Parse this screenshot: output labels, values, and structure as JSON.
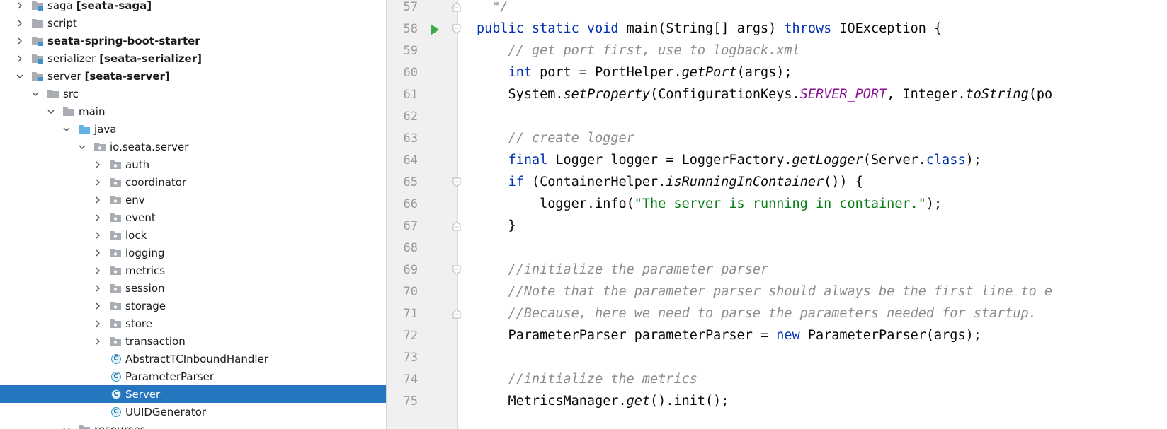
{
  "project_tree": {
    "items": [
      {
        "label": "saga",
        "module": "[seata-saga]",
        "bold": false,
        "arrow": "right",
        "icon": "module-folder-icon",
        "depth": 0
      },
      {
        "label": "script",
        "module": "",
        "bold": false,
        "arrow": "right",
        "icon": "folder-icon",
        "depth": 0
      },
      {
        "label": "seata-spring-boot-starter",
        "module": "",
        "bold": true,
        "arrow": "right",
        "icon": "module-folder-icon",
        "depth": 0
      },
      {
        "label": "serializer",
        "module": "[seata-serializer]",
        "bold": false,
        "arrow": "right",
        "icon": "module-folder-icon",
        "depth": 0
      },
      {
        "label": "server",
        "module": "[seata-server]",
        "bold": false,
        "arrow": "down",
        "icon": "module-folder-icon",
        "depth": 0
      },
      {
        "label": "src",
        "module": "",
        "bold": false,
        "arrow": "down",
        "icon": "folder-icon",
        "depth": 1
      },
      {
        "label": "main",
        "module": "",
        "bold": false,
        "arrow": "down",
        "icon": "folder-icon",
        "depth": 2
      },
      {
        "label": "java",
        "module": "",
        "bold": false,
        "arrow": "down",
        "icon": "source-folder-icon",
        "depth": 3
      },
      {
        "label": "io.seata.server",
        "module": "",
        "bold": false,
        "arrow": "down",
        "icon": "package-icon",
        "depth": 4
      },
      {
        "label": "auth",
        "module": "",
        "bold": false,
        "arrow": "right",
        "icon": "package-icon",
        "depth": 5
      },
      {
        "label": "coordinator",
        "module": "",
        "bold": false,
        "arrow": "right",
        "icon": "package-icon",
        "depth": 5
      },
      {
        "label": "env",
        "module": "",
        "bold": false,
        "arrow": "right",
        "icon": "package-icon",
        "depth": 5
      },
      {
        "label": "event",
        "module": "",
        "bold": false,
        "arrow": "right",
        "icon": "package-icon",
        "depth": 5
      },
      {
        "label": "lock",
        "module": "",
        "bold": false,
        "arrow": "right",
        "icon": "package-icon",
        "depth": 5
      },
      {
        "label": "logging",
        "module": "",
        "bold": false,
        "arrow": "right",
        "icon": "package-icon",
        "depth": 5
      },
      {
        "label": "metrics",
        "module": "",
        "bold": false,
        "arrow": "right",
        "icon": "package-icon",
        "depth": 5
      },
      {
        "label": "session",
        "module": "",
        "bold": false,
        "arrow": "right",
        "icon": "package-icon",
        "depth": 5
      },
      {
        "label": "storage",
        "module": "",
        "bold": false,
        "arrow": "right",
        "icon": "package-icon",
        "depth": 5
      },
      {
        "label": "store",
        "module": "",
        "bold": false,
        "arrow": "right",
        "icon": "package-icon",
        "depth": 5
      },
      {
        "label": "transaction",
        "module": "",
        "bold": false,
        "arrow": "right",
        "icon": "package-icon",
        "depth": 5
      },
      {
        "label": "AbstractTCInboundHandler",
        "module": "",
        "bold": false,
        "arrow": "none",
        "icon": "class-icon",
        "depth": 5
      },
      {
        "label": "ParameterParser",
        "module": "",
        "bold": false,
        "arrow": "none",
        "icon": "class-icon",
        "depth": 5
      },
      {
        "label": "Server",
        "module": "",
        "bold": false,
        "arrow": "none",
        "icon": "class-icon",
        "depth": 5,
        "selected": true
      },
      {
        "label": "UUIDGenerator",
        "module": "",
        "bold": false,
        "arrow": "none",
        "icon": "class-icon",
        "depth": 5
      },
      {
        "label": "resources",
        "module": "",
        "bold": false,
        "arrow": "down",
        "icon": "folder-icon",
        "depth": 3
      }
    ]
  },
  "editor": {
    "lines": [
      {
        "num": "57",
        "run": false,
        "fold": "end",
        "tokens": [
          [
            "  */",
            "cm"
          ]
        ]
      },
      {
        "num": "58",
        "run": true,
        "fold": "start",
        "tokens": [
          [
            "public static void ",
            "kw"
          ],
          [
            "main",
            "fn"
          ],
          [
            "(String[] args) ",
            ""
          ],
          [
            "throws ",
            "kw"
          ],
          [
            "IOException {",
            ""
          ]
        ]
      },
      {
        "num": "59",
        "run": false,
        "fold": "",
        "tokens": [
          [
            "    // get port first, use to logback.xml",
            "cm"
          ]
        ]
      },
      {
        "num": "60",
        "run": false,
        "fold": "",
        "tokens": [
          [
            "    ",
            ""
          ],
          [
            "int ",
            "kw"
          ],
          [
            "port = PortHelper.",
            ""
          ],
          [
            "getPort",
            "it"
          ],
          [
            "(args);",
            ""
          ]
        ]
      },
      {
        "num": "61",
        "run": false,
        "fold": "",
        "tokens": [
          [
            "    System.",
            ""
          ],
          [
            "setProperty",
            "it"
          ],
          [
            "(ConfigurationKeys.",
            ""
          ],
          [
            "SERVER_PORT",
            "cs"
          ],
          [
            ", Integer.",
            ""
          ],
          [
            "toString",
            "it"
          ],
          [
            "(po",
            ""
          ]
        ]
      },
      {
        "num": "62",
        "run": false,
        "fold": "",
        "tokens": [
          [
            "",
            ""
          ]
        ]
      },
      {
        "num": "63",
        "run": false,
        "fold": "",
        "tokens": [
          [
            "    // create logger",
            "cm"
          ]
        ]
      },
      {
        "num": "64",
        "run": false,
        "fold": "",
        "tokens": [
          [
            "    ",
            ""
          ],
          [
            "final ",
            "kw"
          ],
          [
            "Logger logger = LoggerFactory.",
            ""
          ],
          [
            "getLogger",
            "it"
          ],
          [
            "(Server.",
            ""
          ],
          [
            "class",
            "kw"
          ],
          [
            ");",
            ""
          ]
        ]
      },
      {
        "num": "65",
        "run": false,
        "fold": "start",
        "tokens": [
          [
            "    ",
            ""
          ],
          [
            "if ",
            "kw"
          ],
          [
            "(ContainerHelper.",
            ""
          ],
          [
            "isRunningInContainer",
            "it"
          ],
          [
            "()) {",
            ""
          ]
        ]
      },
      {
        "num": "66",
        "run": false,
        "fold": "",
        "tokens": [
          [
            "        logger.info(",
            ""
          ],
          [
            "\"The server is running in container.\"",
            "st"
          ],
          [
            ");",
            ""
          ]
        ]
      },
      {
        "num": "67",
        "run": false,
        "fold": "end",
        "tokens": [
          [
            "    }",
            ""
          ]
        ]
      },
      {
        "num": "68",
        "run": false,
        "fold": "",
        "tokens": [
          [
            "",
            ""
          ]
        ]
      },
      {
        "num": "69",
        "run": false,
        "fold": "start",
        "tokens": [
          [
            "    //initialize the parameter parser",
            "cm"
          ]
        ]
      },
      {
        "num": "70",
        "run": false,
        "fold": "",
        "tokens": [
          [
            "    //Note that the parameter parser should always be the first line to e",
            "cm"
          ]
        ]
      },
      {
        "num": "71",
        "run": false,
        "fold": "end",
        "tokens": [
          [
            "    //Because, here we need to parse the parameters needed for startup.",
            "cm"
          ]
        ]
      },
      {
        "num": "72",
        "run": false,
        "fold": "",
        "tokens": [
          [
            "    ParameterParser parameterParser = ",
            ""
          ],
          [
            "new ",
            "kw"
          ],
          [
            "ParameterParser(args);",
            ""
          ]
        ]
      },
      {
        "num": "73",
        "run": false,
        "fold": "",
        "tokens": [
          [
            "",
            ""
          ]
        ]
      },
      {
        "num": "74",
        "run": false,
        "fold": "",
        "tokens": [
          [
            "    //initialize the metrics",
            "cm"
          ]
        ]
      },
      {
        "num": "75",
        "run": false,
        "fold": "",
        "tokens": [
          [
            "    MetricsManager.",
            ""
          ],
          [
            "get",
            "it"
          ],
          [
            "().init();",
            ""
          ]
        ]
      }
    ]
  },
  "colors": {
    "keyword": "#0033b3",
    "comment": "#8c8c8c",
    "string": "#067d17",
    "constant": "#871094",
    "selection": "#2675bf",
    "run_gutter": "#3daa4a"
  }
}
